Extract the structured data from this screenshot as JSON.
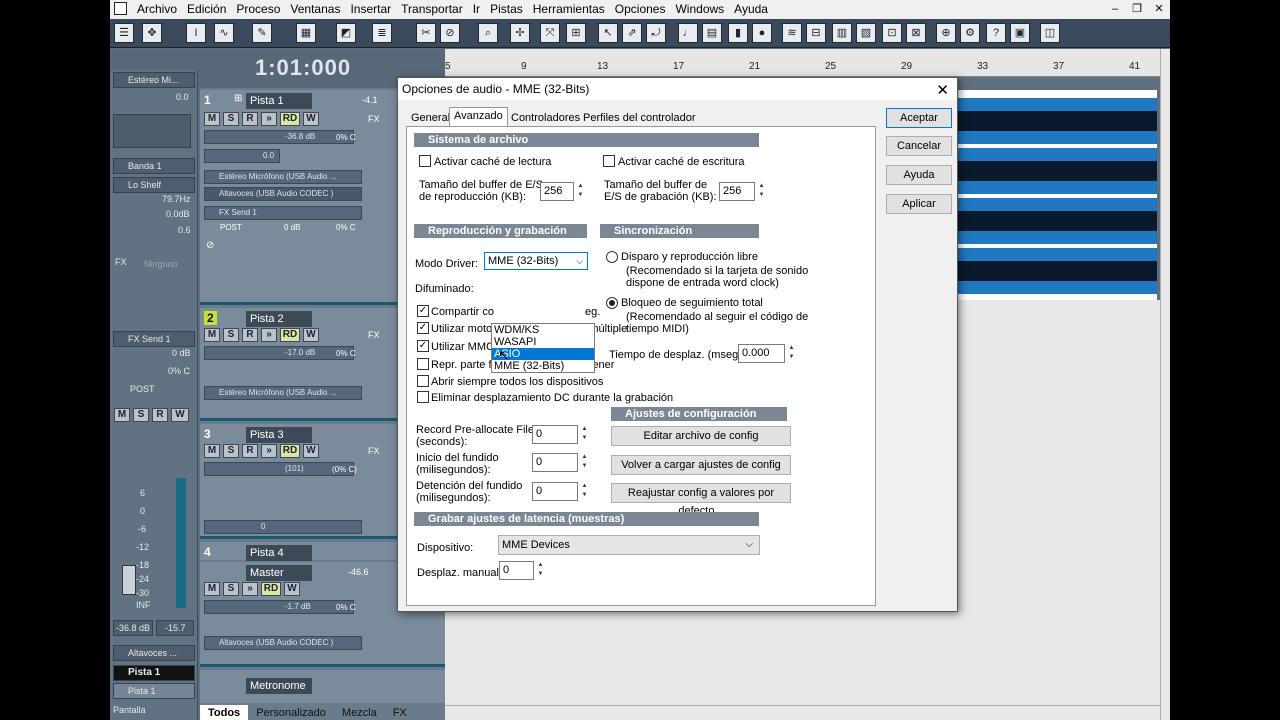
{
  "menu": {
    "items": [
      "Archivo",
      "Edición",
      "Proceso",
      "Ventanas",
      "Insertar",
      "Transportar",
      "Ir",
      "Pistas",
      "Herramientas",
      "Opciones",
      "Windows",
      "Ayuda"
    ],
    "window_controls": [
      "–",
      "❐",
      "✕"
    ]
  },
  "transport": {
    "time": "1:01:000"
  },
  "ruler": {
    "ticks": [
      "5",
      "9",
      "13",
      "17",
      "21",
      "25",
      "29",
      "33",
      "37",
      "41"
    ]
  },
  "left_panel": {
    "source": "Estéreo Mi...",
    "meter_value": "0.0",
    "band": "Banda 1",
    "filter": "Lo Shelf",
    "freq": "79.7Hz",
    "gain": "0.0dB",
    "q": "0.6",
    "fx_label": "FX",
    "fx_slot": "Ninguno",
    "fx_send": "FX Send 1",
    "send_db": "0 dB",
    "send_pan": "0% C",
    "post": "POST",
    "fader_scale": [
      "6",
      "0",
      "-6",
      "-12",
      "-18",
      "-24",
      "-30",
      "INF"
    ],
    "fader_db": "-36.8 dB",
    "peak": "-15.7",
    "output": "Altavoces ...",
    "selected_track": "Pista 1",
    "selected_track2": "Pista 1",
    "display": "Pantalla"
  },
  "tracks": [
    {
      "num": "1",
      "name": "Pista 1",
      "peak": "-4.1",
      "volume": "-36.8 dB",
      "pan": "0% C",
      "trim": "0.0",
      "input": "Estéreo Micrófono (USB Audio ...",
      "output": "Altavoces (USB Audio CODEC )",
      "send": "FX Send 1",
      "send_db": "0 dB",
      "send_pan": "0% C",
      "post": "POST"
    },
    {
      "num": "2",
      "name": "Pista 2",
      "volume": "-17.0 dB",
      "pan": "0% C",
      "input": "Estéreo Micrófono (USB Audio ..."
    },
    {
      "num": "3",
      "name": "Pista 3",
      "volume": "(101)",
      "pan": "(0% C)",
      "trim_row": "0"
    },
    {
      "num": "4",
      "name": "Pista 4"
    },
    {
      "num": "",
      "name": "Master",
      "peak": "-46.6",
      "volume": "-1.7 dB",
      "pan": "0% C",
      "output": "Altavoces (USB Audio CODEC )"
    },
    {
      "num": "",
      "name": "Metronome"
    }
  ],
  "track_buttons": {
    "mute": "M",
    "solo": "S",
    "rec": "R",
    "rd": "RD",
    "write": "W",
    "fx": "FX"
  },
  "bottom_tabs": [
    "Todos",
    "Personalizado",
    "Mezcla",
    "FX"
  ],
  "dialog": {
    "title": "Opciones de audio - MME (32-Bits)",
    "tabs": [
      "General",
      "Avanzado",
      "Controladores",
      "Perfiles del controlador"
    ],
    "selected_tab": "Avanzado",
    "buttons": {
      "ok": "Aceptar",
      "cancel": "Cancelar",
      "help": "Ayuda",
      "apply": "Aplicar"
    },
    "file_system": {
      "header": "Sistema de archivo",
      "read_cache": "Activar caché de lectura",
      "write_cache": "Activar caché de escritura",
      "play_buffer_label_1": "Tamaño del buffer de E/S",
      "play_buffer_label_2": "de reproducción (KB):",
      "play_buffer_value": "256",
      "rec_buffer_label_1": "Tamaño del buffer de",
      "rec_buffer_label_2": "E/S de grabación (KB):",
      "rec_buffer_value": "256"
    },
    "playback": {
      "header": "Reproducción y grabación",
      "driver_mode_label": "Modo Driver:",
      "driver_mode_value": "MME (32-Bits)",
      "driver_options": [
        "WDM/KS",
        "WASAPI",
        "ASIO",
        "MME (32-Bits)"
      ],
      "highlighted_option": "ASIO",
      "dither_label": "Difuminado:",
      "share_label": "Compartir co",
      "share_suffix": "eg.",
      "engine_label": "Utilizar motor de procesamiento múltiple",
      "mmcss_label": "Utilizar MMCSS (Windows Vista)",
      "repro_end_label": "Repr. parte final de efectos al detener",
      "open_all_label": "Abrir siempre todos los dispositivos",
      "dc_label": "Eliminar desplazamiento DC durante la grabación"
    },
    "sync": {
      "header": "Sincronización",
      "free_label": "Disparo y reproducción libre",
      "free_desc_1": "(Recomendado si la tarjeta de sonido",
      "free_desc_2": "dispone de entrada word clock)",
      "lock_label": "Bloqueo de seguimiento total",
      "lock_desc_1": "(Recomendado al seguir el código de",
      "lock_desc_2": "tiempo MIDI)",
      "offset_label": "Tiempo de desplaz. (mseg.):",
      "offset_value": "0.000"
    },
    "prealloc": {
      "record_label_1": "Record Pre-allocate File",
      "record_label_2": "(seconds):",
      "record_value": "0",
      "fadein_label_1": "Inicio del fundido",
      "fadein_label_2": "(milisegundos):",
      "fadein_value": "0",
      "fadeout_label_1": "Detención del fundido",
      "fadeout_label_2": "(milisegundos):",
      "fadeout_value": "0"
    },
    "config": {
      "header": "Ajustes de configuración",
      "edit": "Editar archivo de config",
      "reload": "Volver a cargar ajustes de config",
      "reset": "Reajustar config a valores por defecto..."
    },
    "latency": {
      "header": "Grabar ajustes de latencia (muestras)",
      "device_label": "Dispositivo:",
      "device_value": "MME Devices",
      "manual_label": "Desplaz. manual:",
      "manual_value": "0"
    }
  }
}
